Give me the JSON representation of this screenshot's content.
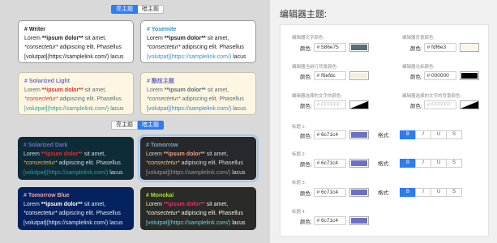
{
  "light_toggle": {
    "light": "亮主题",
    "dark": "暗主题"
  },
  "dark_toggle": {
    "light": "亮主题",
    "dark": "暗主题"
  },
  "sample": {
    "l2a": "Lorem ",
    "l2b": "**ipsum dolor**",
    "l2c": " sit amet,",
    "l3a": "*consectetur*",
    "l3b": " adipiscing elit. Phasellus",
    "l4a": "[volutpat](https://samplelink.com/)",
    "l4b": " lacus"
  },
  "themes": {
    "writer": "# Writer",
    "yosemite": "# Yosemite",
    "solarized_light": "# Solarized Light",
    "zen": "# 酷炫主题",
    "solarized_dark": "# Solarized Dark",
    "tomorrow": "# Tomorrow",
    "tomorrow_blue": "# Tomorrow Blue",
    "monokai": "# Monokai"
  },
  "editor": {
    "title": "编辑器主题:",
    "font_color_label": "编辑器文字颜色:",
    "bg_color_label": "编辑器背景颜色:",
    "line_bg_label": "编辑器当前行背景颜色:",
    "cursor_label": "编辑器光标颜色:",
    "sel_text_label": "编辑器选择的文字的颜色:",
    "sel_bg_label": "编辑器选择的文字的背景颜色:",
    "color_prefix": "颜色:",
    "format_prefix": "格式:",
    "font_color": "# 586e75",
    "bg_color": "# fdf6e3",
    "line_bg": "# f6efdc",
    "cursor": "# 000000",
    "sel_text": "# FFFFFF",
    "sel_bg": "# FFFFFF",
    "h1_label": "标题 1:",
    "h2_label": "标题 2:",
    "h3_label": "标题 3:",
    "h4_label": "标题 4:",
    "h1_color": "# 6c71c4",
    "h2_color": "# 6c71c4",
    "h3_color": "# 6c71c4",
    "h4_color": "# 6c71c4",
    "fmt": {
      "b": "B",
      "i": "I",
      "u": "U",
      "s": "S"
    }
  },
  "colors": {
    "accent": "#2d7cf0",
    "heading_swatch": "#6c71c4",
    "font_swatch": "#586e75",
    "bg_swatch": "#fdf6e3",
    "line_swatch": "#f6efdc",
    "cursor_swatch": "#000000"
  }
}
